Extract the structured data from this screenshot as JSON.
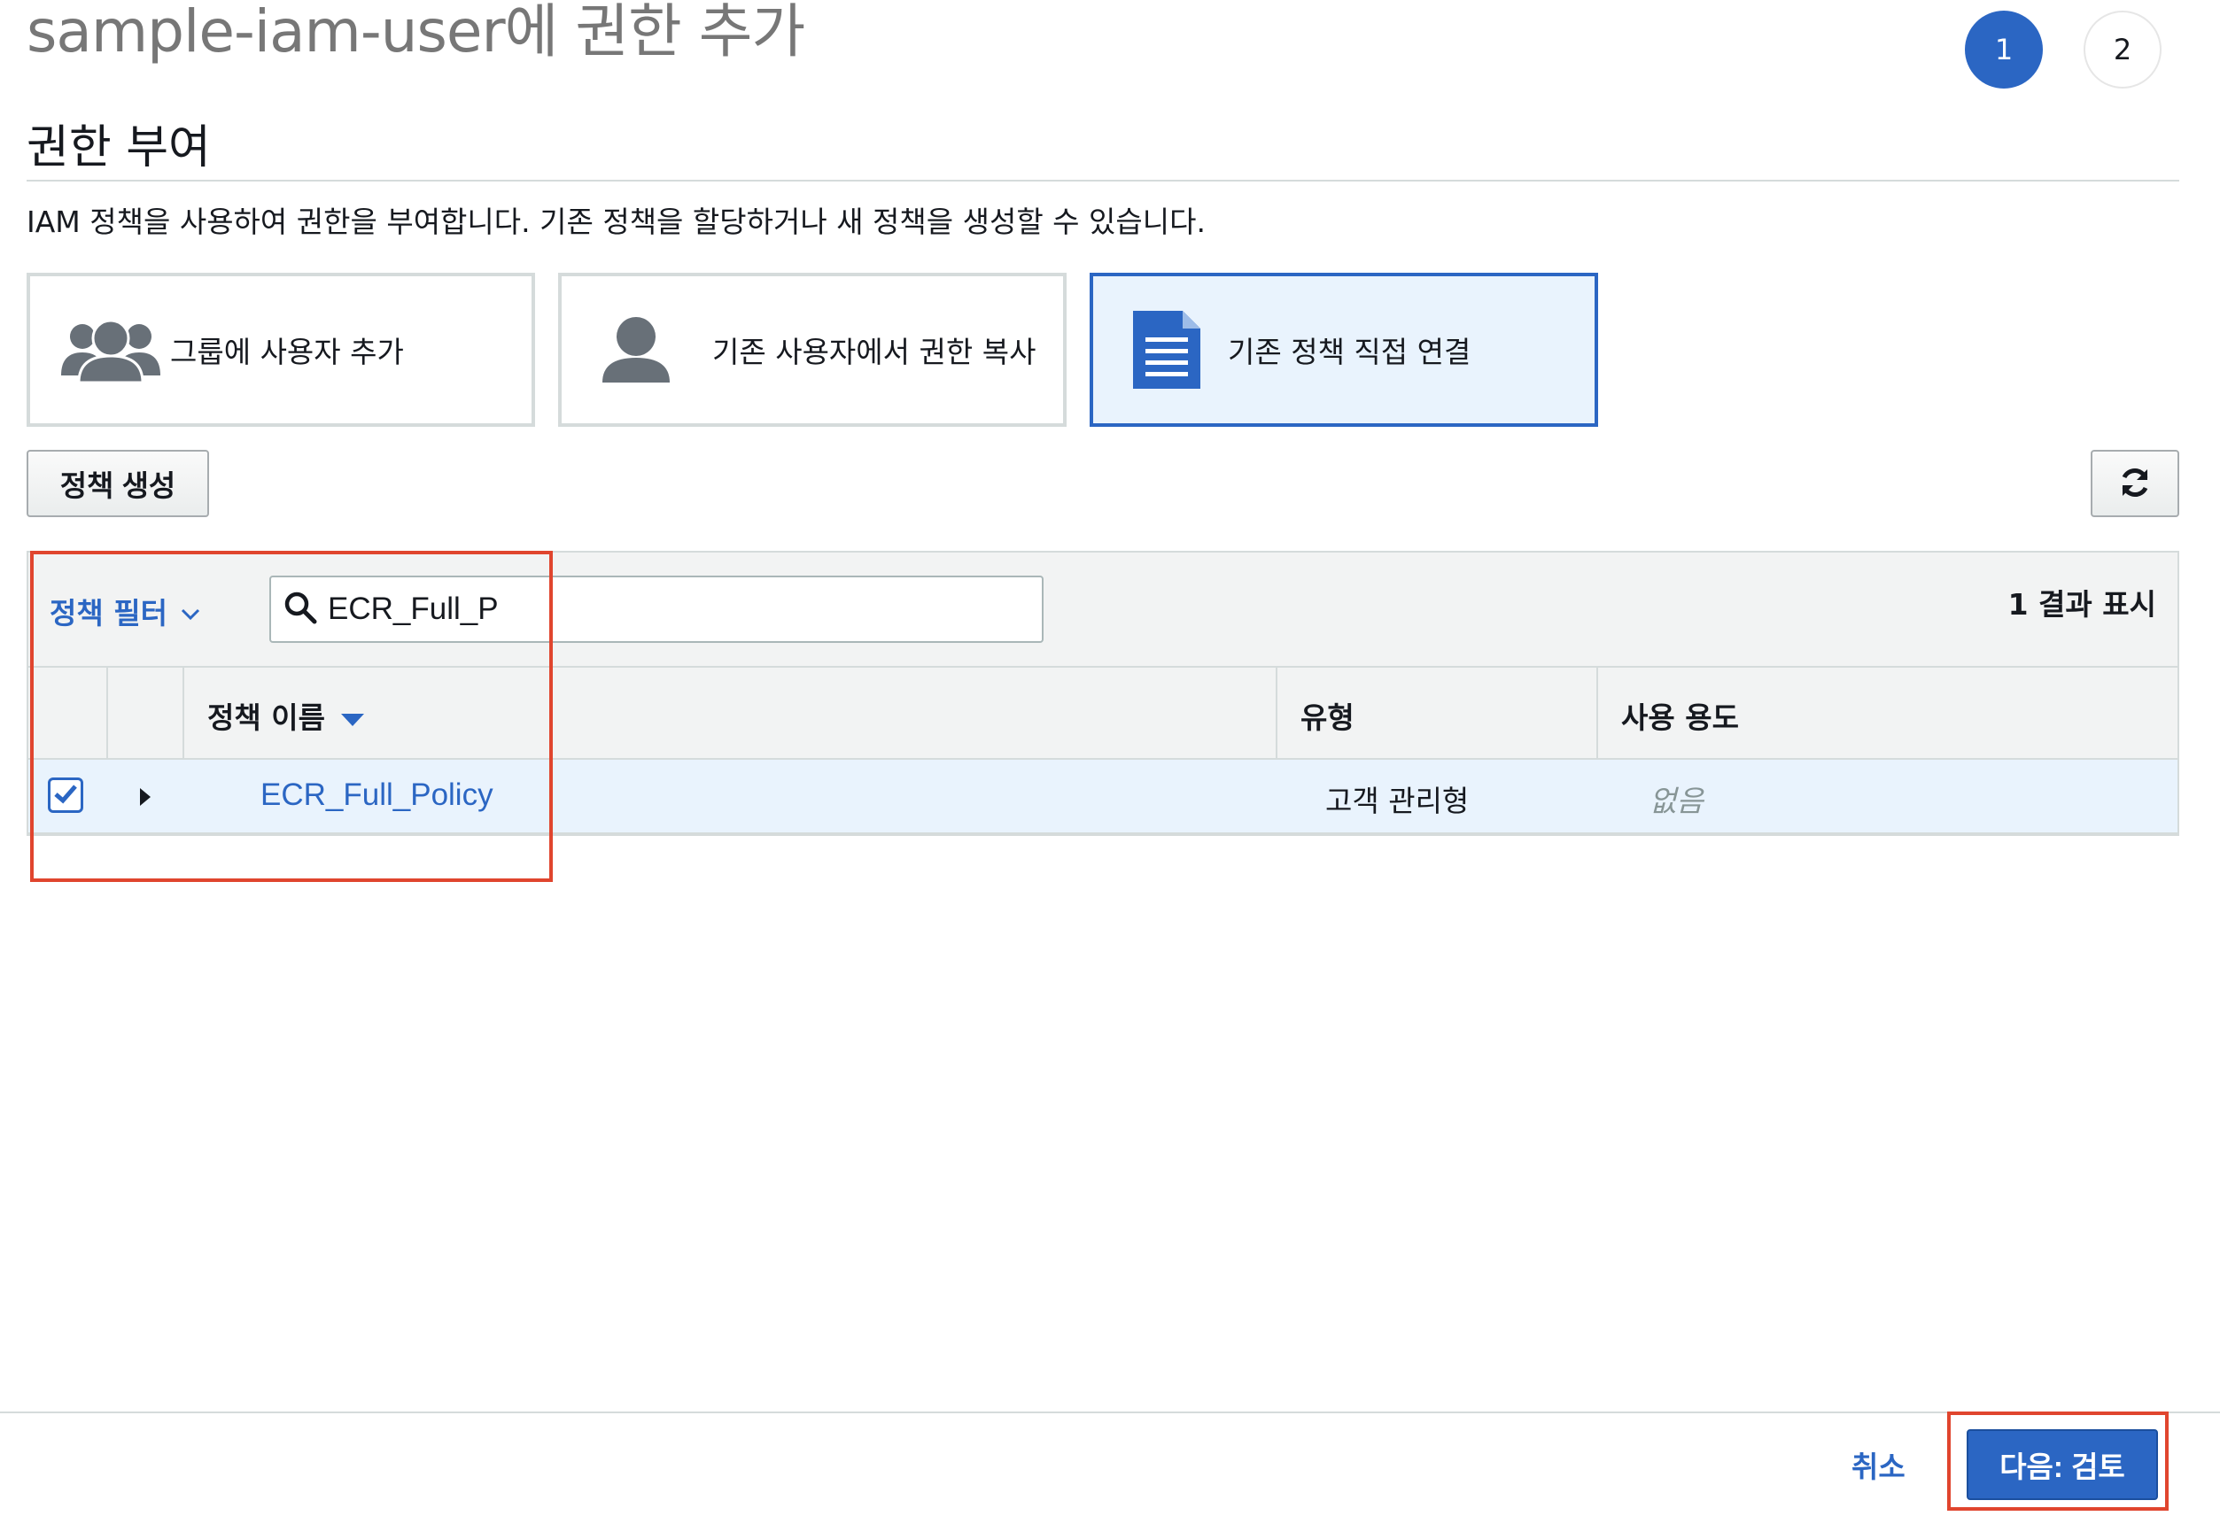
{
  "header": {
    "title": "sample-iam-user에 권한 추가",
    "steps": [
      "1",
      "2"
    ],
    "active_step": "1"
  },
  "section": {
    "title": "권한 부여",
    "description": "IAM 정책을 사용하여 권한을 부여합니다. 기존 정책을 할당하거나 새 정책을 생성할 수 있습니다."
  },
  "options": [
    {
      "label": "그룹에 사용자 추가",
      "icon": "group-icon"
    },
    {
      "label": "기존 사용자에서 권한 복사",
      "icon": "user-icon"
    },
    {
      "label": "기존 정책 직접 연결",
      "icon": "document-icon",
      "selected": true
    }
  ],
  "toolbar": {
    "create_policy_label": "정책 생성",
    "refresh_icon": "refresh-icon"
  },
  "filter": {
    "label": "정책 필터",
    "search_value": "ECR_Full_P",
    "result_count": "1 결과 표시"
  },
  "table": {
    "columns": [
      "정책 이름",
      "유형",
      "사용 용도"
    ],
    "rows": [
      {
        "checked": true,
        "name": "ECR_Full_Policy",
        "type": "고객 관리형",
        "usage": "없음"
      }
    ]
  },
  "footer": {
    "cancel_label": "취소",
    "next_label": "다음: 검토"
  },
  "colors": {
    "accent": "#2b66c3",
    "selected_bg": "#e9f3fd",
    "highlight": "#e0452e"
  }
}
